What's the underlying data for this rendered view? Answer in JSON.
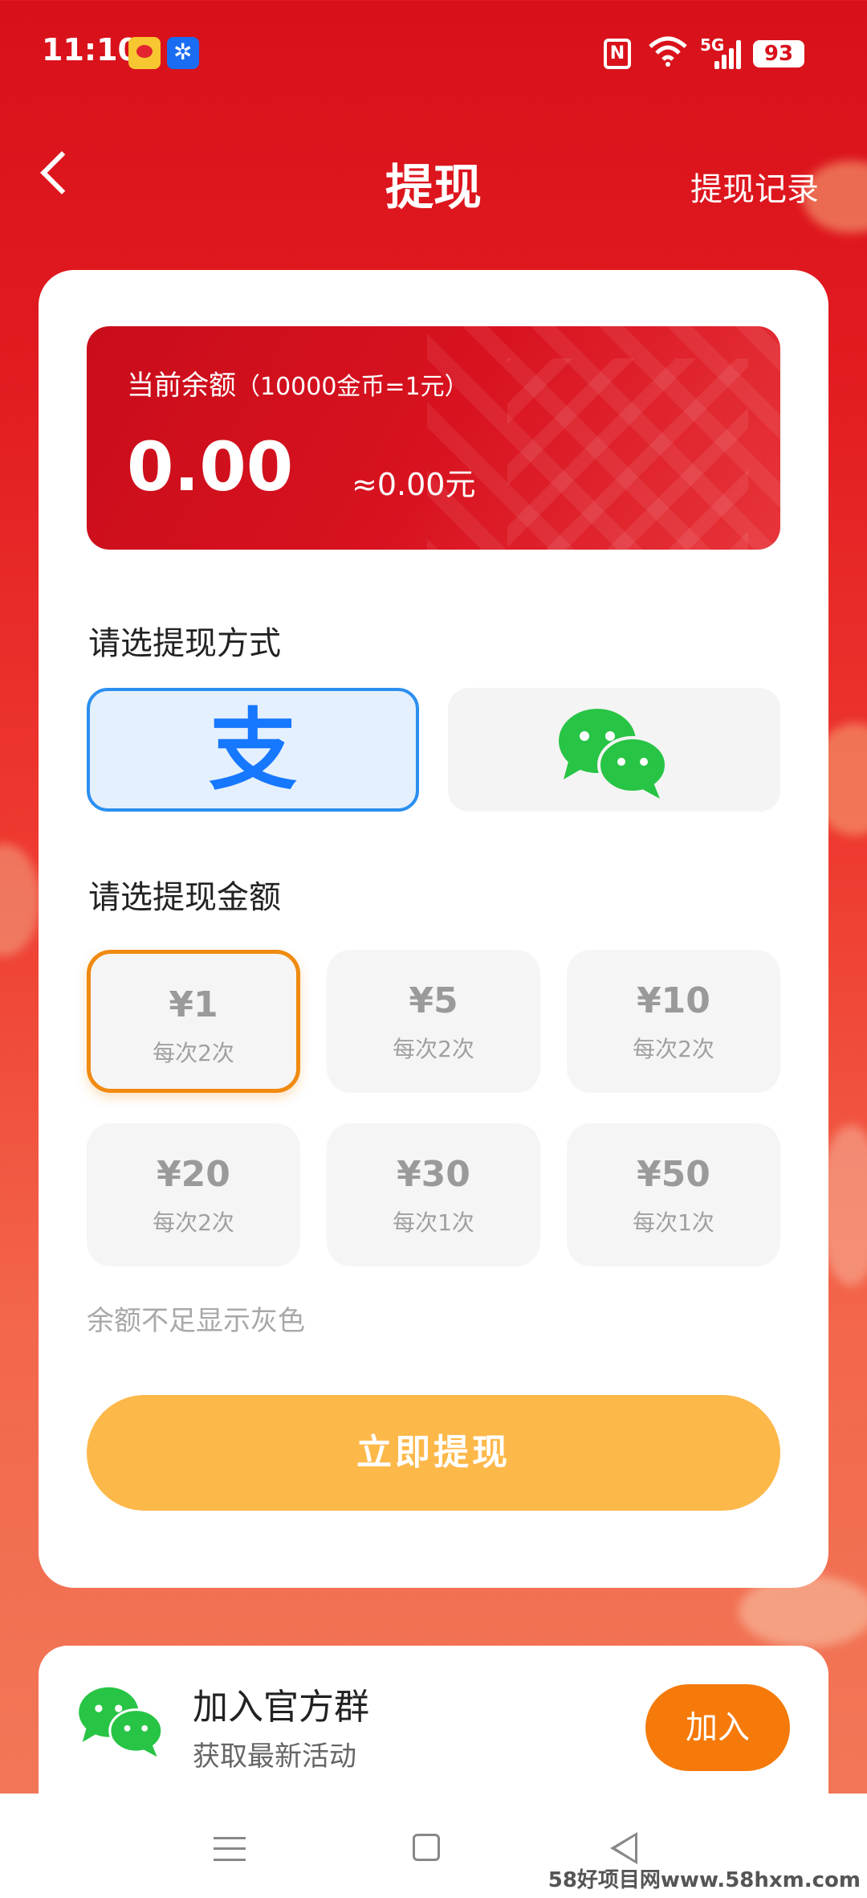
{
  "status_bar": {
    "time": "11:10",
    "network": "5G",
    "nfc": "N",
    "battery": "93"
  },
  "header": {
    "title": "提现",
    "record_link": "提现记录"
  },
  "balance": {
    "label": "当前余额",
    "rate": "（10000金币=1元）",
    "amount": "0.00",
    "approx": "≈0.00元"
  },
  "method_section": {
    "label": "请选提现方式",
    "options": [
      {
        "name": "alipay",
        "glyph": "支",
        "selected": true
      },
      {
        "name": "wechat",
        "selected": false
      }
    ]
  },
  "amount_section": {
    "label": "请选提现金额",
    "options": [
      {
        "value": "¥1",
        "sub": "每次2次",
        "selected": true
      },
      {
        "value": "¥5",
        "sub": "每次2次"
      },
      {
        "value": "¥10",
        "sub": "每次2次"
      },
      {
        "value": "¥20",
        "sub": "每次2次"
      },
      {
        "value": "¥30",
        "sub": "每次1次"
      },
      {
        "value": "¥50",
        "sub": "每次1次"
      }
    ],
    "hint": "余额不足显示灰色"
  },
  "cta": {
    "label": "立即提现"
  },
  "group": {
    "title": "加入官方群",
    "subtitle": "获取最新活动",
    "button": "加入"
  },
  "watermark": "58好项目网www.58hxm.com",
  "colors": {
    "primary_red": "#d8101a",
    "cta_orange": "#fdb84a",
    "join_orange": "#f57a0a",
    "alipay_blue": "#1677ff",
    "wechat_green": "#28c445",
    "selected_border": "#f08a10"
  }
}
